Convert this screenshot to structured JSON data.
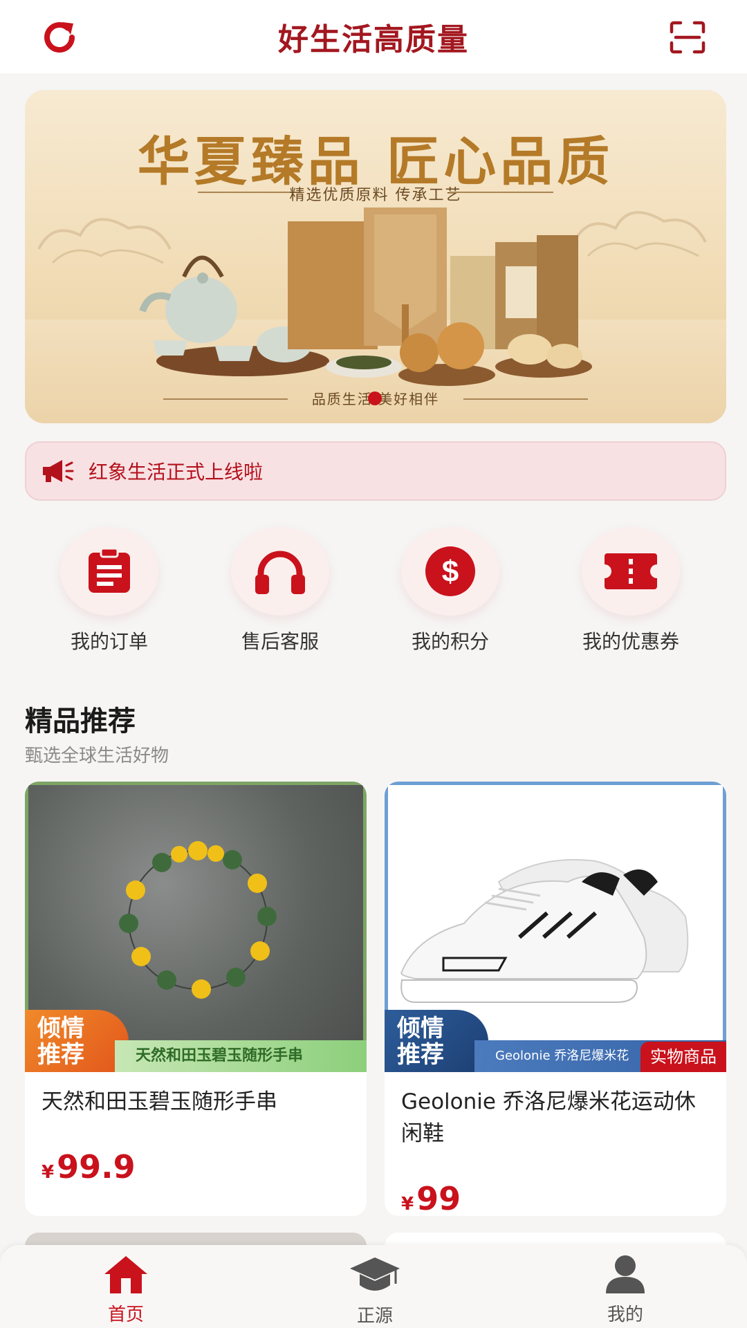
{
  "header": {
    "title": "好生活高质量",
    "left_icon": "refresh-icon",
    "right_icon": "scan-icon"
  },
  "banner": {
    "title": "华夏臻品 匠心品质",
    "subtitle": "精选优质原料 传承工艺",
    "footer": "品质生活 美好相伴",
    "carousel_active_index": 1
  },
  "notice": {
    "icon": "megaphone-icon",
    "text": "红象生活正式上线啦"
  },
  "quick_links": [
    {
      "label": "我的订单",
      "icon": "clipboard-icon"
    },
    {
      "label": "售后客服",
      "icon": "headphones-icon"
    },
    {
      "label": "我的积分",
      "icon": "dollar-icon"
    },
    {
      "label": "我的优惠券",
      "icon": "ticket-icon"
    }
  ],
  "section": {
    "title": "精品推荐",
    "subtitle": "甄选全球生活好物"
  },
  "products": [
    {
      "name": "天然和田玉碧玉随形手串",
      "price_symbol": "¥",
      "price": "99.9",
      "tag": "倾情推荐",
      "strip": "天然和田玉碧玉随形手串",
      "badge": ""
    },
    {
      "name": "Geolonie 乔洛尼爆米花运动休闲鞋",
      "price_symbol": "¥",
      "price": "99",
      "tag": "倾情推荐",
      "strip": "Geolonie 乔洛尼爆米花",
      "badge": "实物商品"
    }
  ],
  "bottom_nav": [
    {
      "label": "首页",
      "icon": "home-icon",
      "active": true
    },
    {
      "label": "正源",
      "icon": "graduation-cap-icon",
      "active": false
    },
    {
      "label": "我的",
      "icon": "user-icon",
      "active": false
    }
  ],
  "colors": {
    "brand_red": "#c9121c",
    "title_red": "#a3171f",
    "notice_bg": "#f8e1e3"
  }
}
